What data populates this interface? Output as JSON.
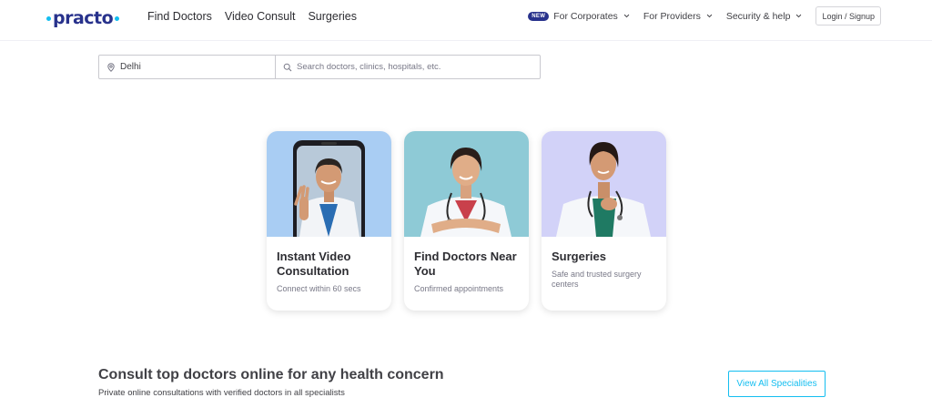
{
  "brand": {
    "name": "practo",
    "accent": "#14bef0",
    "primary": "#28328c"
  },
  "nav": {
    "main": [
      "Find Doctors",
      "Video Consult",
      "Surgeries"
    ],
    "new_badge": "NEW",
    "corporates": "For Corporates",
    "providers": "For Providers",
    "security": "Security & help",
    "login": "Login / Signup"
  },
  "search": {
    "location_value": "Delhi",
    "query_placeholder": "Search doctors, clinics, hospitals, etc.",
    "location_icon": "location-pin-icon",
    "query_icon": "search-icon"
  },
  "cards": [
    {
      "title": "Instant Video Consultation",
      "subtitle": "Connect within 60 secs",
      "bg": "#a9cdf3"
    },
    {
      "title": "Find Doctors Near You",
      "subtitle": "Confirmed appointments",
      "bg": "#8ecad6"
    },
    {
      "title": "Surgeries",
      "subtitle": "Safe and trusted surgery centers",
      "bg": "#d2d2f8"
    }
  ],
  "consult": {
    "title": "Consult top doctors online for any health concern",
    "subtitle": "Private online consultations with verified doctors in all specialists",
    "view_all": "View All Specialities"
  }
}
